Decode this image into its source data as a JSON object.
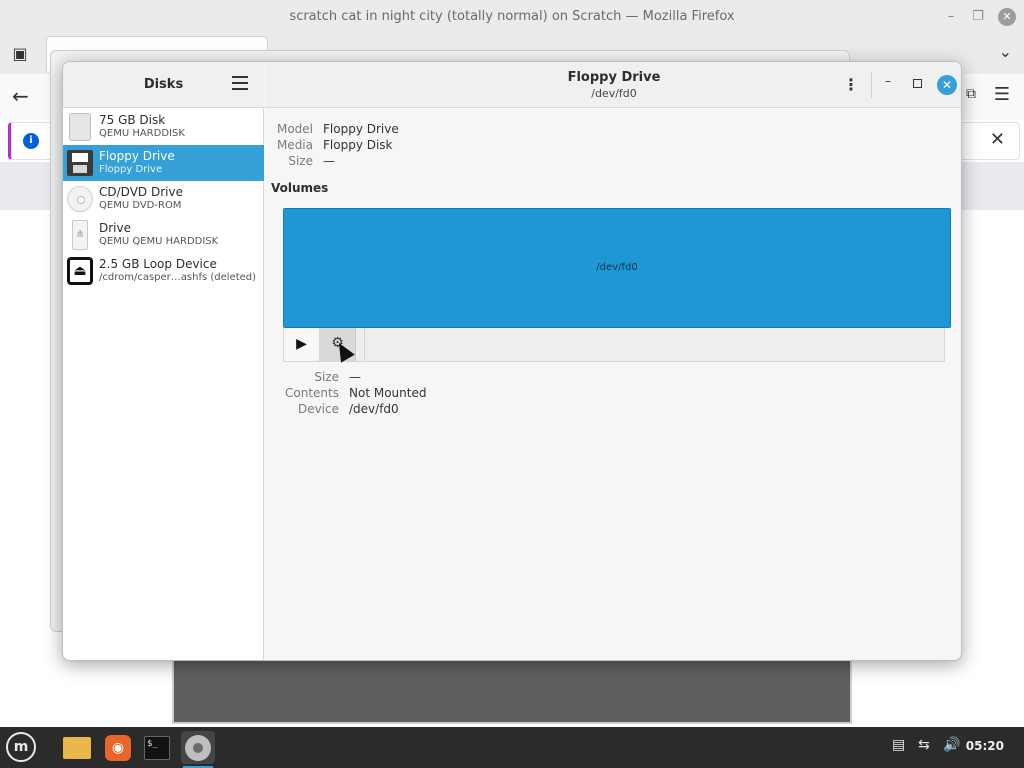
{
  "firefox": {
    "title": "scratch cat in night city (totally normal) on Scratch — Mozilla Firefox",
    "min_glyph": "–",
    "max_glyph": "❐",
    "close_glyph": "✕",
    "back_glyph": "←",
    "menu_glyph": "☰",
    "ext_glyph": "⧉",
    "tabs_glyph": "▣",
    "chevron_glyph": "⌄",
    "info_glyph": "i",
    "notif_close_glyph": "✕",
    "notif_accent": "#b52cd6"
  },
  "disks": {
    "sidebar_title": "Disks",
    "items": [
      {
        "name": "75 GB Disk",
        "sub": "QEMU HARDDISK",
        "icon": "hdd-icon"
      },
      {
        "name": "Floppy Drive",
        "sub": "Floppy Drive",
        "icon": "floppy-icon",
        "selected": true
      },
      {
        "name": "CD/DVD Drive",
        "sub": "QEMU DVD-ROM",
        "icon": "cd-icon"
      },
      {
        "name": "Drive",
        "sub": "QEMU QEMU HARDDISK",
        "icon": "usb-drive-icon"
      },
      {
        "name": "2.5 GB Loop Device",
        "sub": "/cdrom/casper…ashfs (deleted)",
        "icon": "eject-icon"
      }
    ],
    "header": {
      "title": "Floppy Drive",
      "subtitle": "/dev/fd0",
      "kebab_glyph": "⋮",
      "min_glyph": "–",
      "close_glyph": "✕"
    },
    "info": {
      "model_label": "Model",
      "model_value": "Floppy Drive",
      "media_label": "Media",
      "media_value": "Floppy Disk",
      "size_label": "Size",
      "size_value": "—"
    },
    "volumes_heading": "Volumes",
    "volume": {
      "label": "/dev/fd0",
      "play_glyph": "▶",
      "gear_glyph": "⚙",
      "size_label": "Size",
      "size_value": "—",
      "contents_label": "Contents",
      "contents_value": "Not Mounted",
      "device_label": "Device",
      "device_value": "/dev/fd0"
    },
    "accent": "#35a1d8"
  },
  "taskbar": {
    "menu_glyph": "m",
    "firefox_glyph": "◉",
    "terminal_glyph": "$_",
    "tray_notes_glyph": "▤",
    "tray_network_glyph": "⇆",
    "tray_volume_glyph": "🔊",
    "clock": "05:20"
  }
}
